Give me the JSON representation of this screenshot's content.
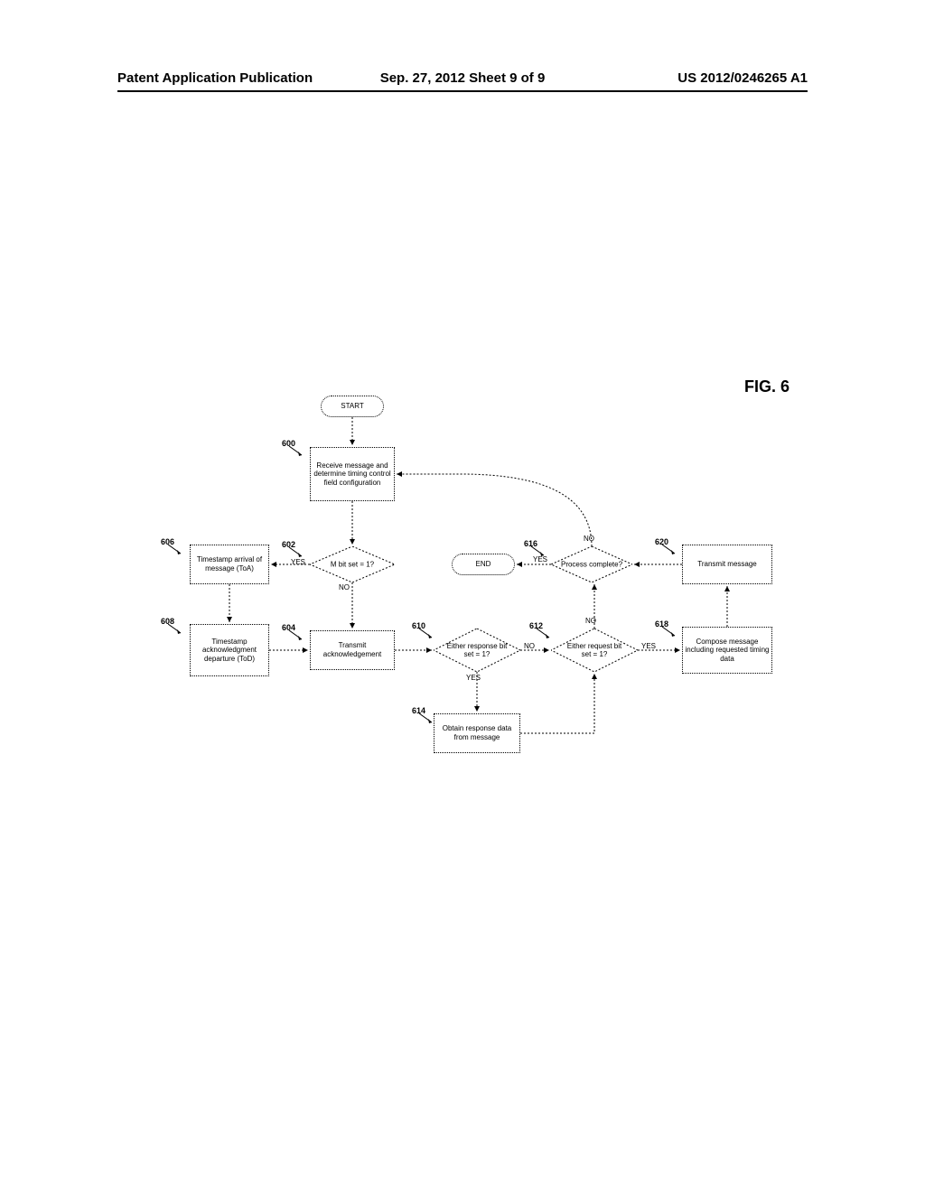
{
  "header": {
    "left": "Patent Application Publication",
    "center": "Sep. 27, 2012  Sheet 9 of 9",
    "right": "US 2012/0246265 A1"
  },
  "figure_label": "FIG. 6",
  "refs": {
    "r600": "600",
    "r602": "602",
    "r604": "604",
    "r606": "606",
    "r608": "608",
    "r610": "610",
    "r612": "612",
    "r614": "614",
    "r616": "616",
    "r618": "618",
    "r620": "620"
  },
  "nodes": {
    "start": "START",
    "end": "END",
    "n600": "Receive message and determine timing control field configuration",
    "n602": "M bit set = 1?",
    "n604": "Transmit acknowledgement",
    "n606": "Timestamp arrival of message (ToA)",
    "n608": "Timestamp acknowledgment departure (ToD)",
    "n610": "Either response bit set = 1?",
    "n612": "Either request bit set = 1?",
    "n614": "Obtain response data from message",
    "n616": "Process complete?",
    "n618": "Compose message including requested timing data",
    "n620": "Transmit message"
  },
  "edges": {
    "yes": "YES",
    "no": "NO"
  }
}
